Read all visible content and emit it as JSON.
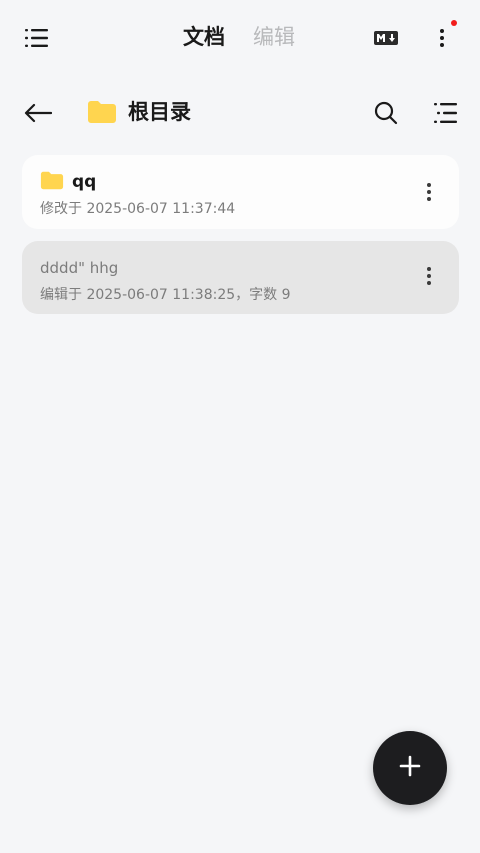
{
  "header": {
    "tabs": [
      {
        "label": "文档",
        "active": true
      },
      {
        "label": "编辑",
        "active": false
      }
    ],
    "icons": [
      "list-menu-icon",
      "markdown-icon",
      "more-vertical-icon"
    ],
    "notification_dot_color": "#f21c1c"
  },
  "path": {
    "title": "根目录",
    "icons": [
      "back-arrow-icon",
      "folder-icon",
      "search-icon",
      "sort-list-icon"
    ],
    "folder_color": "#ffd54f"
  },
  "items": [
    {
      "type": "folder",
      "name": "qq",
      "subtitle": "修改于 2025-06-07 11:37:44"
    },
    {
      "type": "note",
      "name": "dddd\"  hhg",
      "subtitle": "编辑于 2025-06-07 11:38:25，字数 9"
    }
  ],
  "fab": {
    "icon": "plus-icon"
  }
}
